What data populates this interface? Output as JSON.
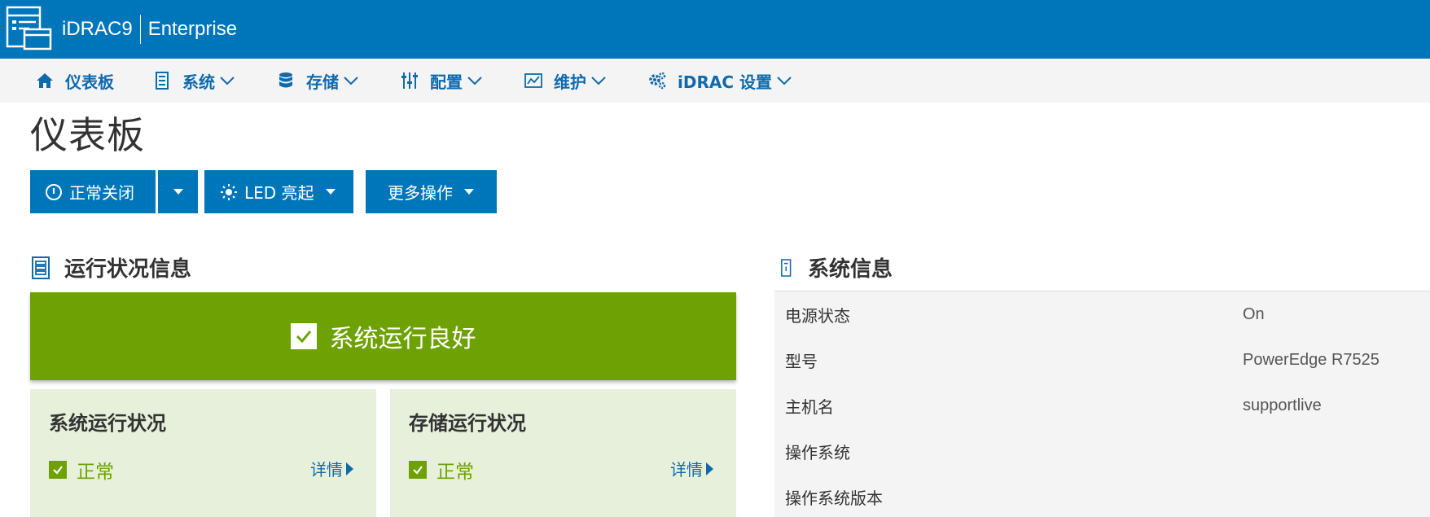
{
  "header": {
    "product": "iDRAC9",
    "edition": "Enterprise",
    "colors": {
      "brand_blue": "#0076ba",
      "health_green": "#6ea204",
      "link_blue": "#0f6aad",
      "card_bg": "#e7f0da"
    }
  },
  "nav": {
    "items": [
      {
        "label": "仪表板",
        "icon": "home-icon",
        "has_dropdown": false
      },
      {
        "label": "系统",
        "icon": "server-icon",
        "has_dropdown": true
      },
      {
        "label": "存储",
        "icon": "database-icon",
        "has_dropdown": true
      },
      {
        "label": "配置",
        "icon": "sliders-icon",
        "has_dropdown": true
      },
      {
        "label": "维护",
        "icon": "chart-icon",
        "has_dropdown": true
      },
      {
        "label": "iDRAC 设置",
        "icon": "gears-icon",
        "has_dropdown": true
      }
    ]
  },
  "page": {
    "title": "仪表板"
  },
  "actions": {
    "shutdown_label": "正常关闭",
    "led_label": "LED 亮起",
    "more_label": "更多操作"
  },
  "health": {
    "heading": "运行状况信息",
    "banner_text": "系统运行良好",
    "cards": [
      {
        "title": "系统运行状况",
        "status": "正常",
        "link": "详情"
      },
      {
        "title": "存储运行状况",
        "status": "正常",
        "link": "详情"
      }
    ]
  },
  "system_info": {
    "heading": "系统信息",
    "rows": [
      {
        "key": "电源状态",
        "value": "On"
      },
      {
        "key": "型号",
        "value": "PowerEdge R7525"
      },
      {
        "key": "主机名",
        "value": "supportlive"
      },
      {
        "key": "操作系统",
        "value": ""
      },
      {
        "key": "操作系统版本",
        "value": ""
      }
    ]
  }
}
